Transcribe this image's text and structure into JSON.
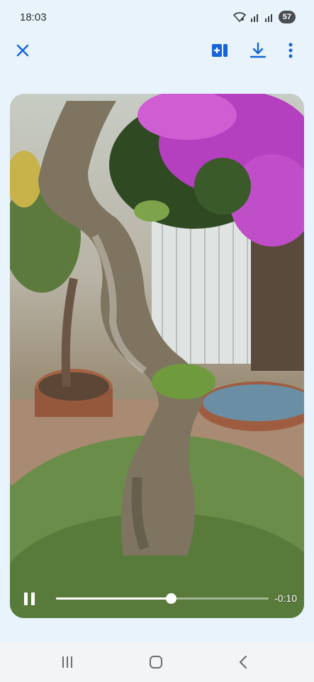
{
  "status_bar": {
    "time": "18:03",
    "battery": "57",
    "icons": [
      "wifi-icon",
      "signal-icon",
      "signal-icon"
    ]
  },
  "toolbar": {
    "close_icon": "close-icon",
    "actions": [
      "add-to-drive-icon",
      "download-icon",
      "more-vert-icon"
    ],
    "accent": "#1565d8"
  },
  "video": {
    "progress": 0.54,
    "time_remaining": "-0:10",
    "playing": true
  },
  "nav_bar": {
    "icons": [
      "recents-icon",
      "home-icon",
      "back-icon"
    ]
  }
}
